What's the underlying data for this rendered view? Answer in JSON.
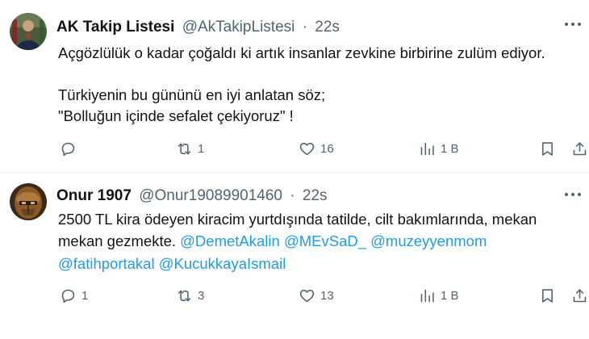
{
  "tweets": [
    {
      "author_name": "AK Takip Listesi",
      "handle": "@AkTakipListesi",
      "separator": "·",
      "time": "22s",
      "lines": [
        "Açgözlülük o kadar çoğaldı ki artık insanlar zevkine birbirine zulüm ediyor.",
        "Türkiyenin bu gününü en iyi anlatan söz;",
        "\"Bolluğun içinde sefalet çekiyoruz\" !"
      ],
      "replies": "",
      "retweets": "1",
      "likes": "16",
      "views": "1 B"
    },
    {
      "author_name": "Onur 1907",
      "handle": "@Onur19089901460",
      "separator": "·",
      "time": "22s",
      "line1": "2500 TL kira ödeyen  kiracim yurtdışında tatilde, cilt bakımlarında, mekan",
      "line2_text": "mekan gezmekte.",
      "mentions": [
        "@DemetAkalin",
        "@MEvSaD_",
        "@muzeyyenmom",
        "@fatihportakal",
        "@KucukkayaIsmail"
      ],
      "replies": "1",
      "retweets": "3",
      "likes": "13",
      "views": "1 B"
    }
  ],
  "icons": {
    "avatar_1": "avatar-photo-icon",
    "avatar_2": "avatar-photo-icon",
    "reply": "reply-icon",
    "retweet": "retweet-icon",
    "like": "heart-icon",
    "views": "views-chart-icon",
    "bookmark": "bookmark-icon",
    "share": "share-icon",
    "more": "more-dots-icon"
  },
  "colors": {
    "text": "#0f1419",
    "secondary": "#536471",
    "link": "#1d9bf0",
    "divider": "#eff3f4"
  }
}
